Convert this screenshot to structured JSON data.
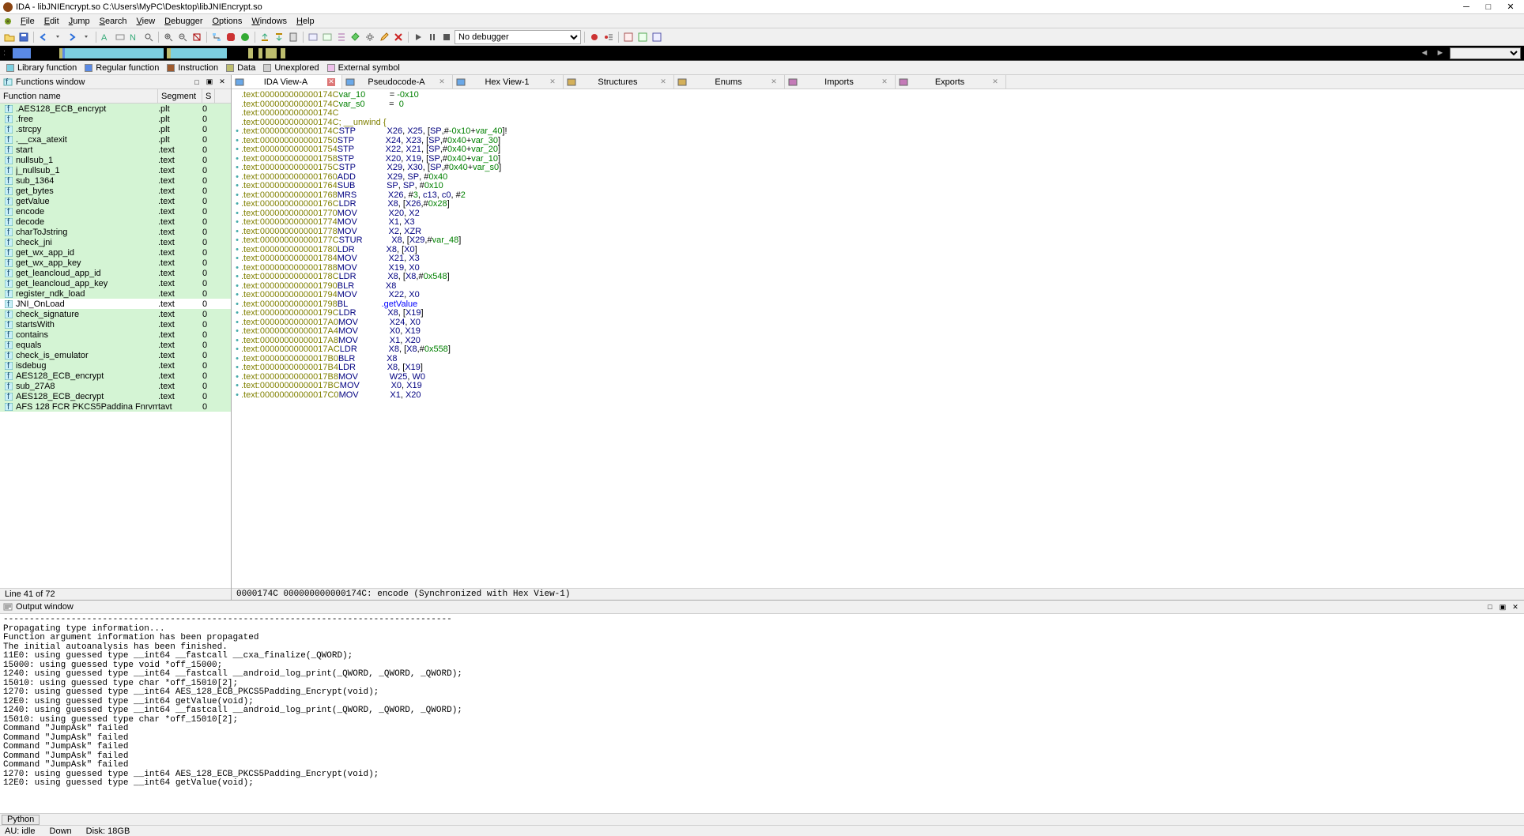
{
  "title": "IDA - libJNIEncrypt.so C:\\Users\\MyPC\\Desktop\\libJNIEncrypt.so",
  "menu": [
    "File",
    "Edit",
    "Jump",
    "Search",
    "View",
    "Debugger",
    "Options",
    "Windows",
    "Help"
  ],
  "debugger_select": "No debugger",
  "legend": [
    {
      "label": "Library function",
      "color": "#7ccfe0"
    },
    {
      "label": "Regular function",
      "color": "#5a8ae6"
    },
    {
      "label": "Instruction",
      "color": "#9e5a2e"
    },
    {
      "label": "Data",
      "color": "#bdbd6e"
    },
    {
      "label": "Unexplored",
      "color": "#d0d0d0"
    },
    {
      "label": "External symbol",
      "color": "#eec0ea"
    }
  ],
  "nav_segments": [
    {
      "color": "#5a8ae6",
      "w": 1.3
    },
    {
      "color": "#000000",
      "w": 2.0
    },
    {
      "color": "#bdbd6e",
      "w": 0.2
    },
    {
      "color": "#5a8ae6",
      "w": 0.2
    },
    {
      "color": "#7ccfe0",
      "w": 7.0
    },
    {
      "color": "#000000",
      "w": 0.2
    },
    {
      "color": "#bdbd6e",
      "w": 0.3
    },
    {
      "color": "#7ccfe0",
      "w": 4.0
    },
    {
      "color": "#000000",
      "w": 1.5
    },
    {
      "color": "#bdbd6e",
      "w": 0.3
    },
    {
      "color": "#000000",
      "w": 0.4
    },
    {
      "color": "#bdbd6e",
      "w": 0.3
    },
    {
      "color": "#000000",
      "w": 0.2
    },
    {
      "color": "#bdbd6e",
      "w": 0.8
    },
    {
      "color": "#000000",
      "w": 0.3
    },
    {
      "color": "#bdbd6e",
      "w": 0.3
    },
    {
      "color": "#000000",
      "w": 80
    }
  ],
  "functions_panel": {
    "title": "Functions window",
    "cols": [
      "Function name",
      "Segment",
      "S"
    ],
    "status": "Line 41 of 72",
    "rows": [
      {
        "name": ".AES128_ECB_encrypt",
        "seg": ".plt",
        "s": "0",
        "hl": true
      },
      {
        "name": ".free",
        "seg": ".plt",
        "s": "0",
        "hl": true
      },
      {
        "name": ".strcpy",
        "seg": ".plt",
        "s": "0",
        "hl": true
      },
      {
        "name": ".__cxa_atexit",
        "seg": ".plt",
        "s": "0",
        "hl": true
      },
      {
        "name": "start",
        "seg": ".text",
        "s": "0",
        "hl": true
      },
      {
        "name": "nullsub_1",
        "seg": ".text",
        "s": "0",
        "hl": true
      },
      {
        "name": "j_nullsub_1",
        "seg": ".text",
        "s": "0",
        "hl": true
      },
      {
        "name": "sub_1364",
        "seg": ".text",
        "s": "0",
        "hl": true
      },
      {
        "name": "get_bytes",
        "seg": ".text",
        "s": "0",
        "hl": true
      },
      {
        "name": "getValue",
        "seg": ".text",
        "s": "0",
        "hl": true
      },
      {
        "name": "encode",
        "seg": ".text",
        "s": "0",
        "hl": true
      },
      {
        "name": "decode",
        "seg": ".text",
        "s": "0",
        "hl": true
      },
      {
        "name": "charToJstring",
        "seg": ".text",
        "s": "0",
        "hl": true
      },
      {
        "name": "check_jni",
        "seg": ".text",
        "s": "0",
        "hl": true
      },
      {
        "name": "get_wx_app_id",
        "seg": ".text",
        "s": "0",
        "hl": true
      },
      {
        "name": "get_wx_app_key",
        "seg": ".text",
        "s": "0",
        "hl": true
      },
      {
        "name": "get_leancloud_app_id",
        "seg": ".text",
        "s": "0",
        "hl": true
      },
      {
        "name": "get_leancloud_app_key",
        "seg": ".text",
        "s": "0",
        "hl": true
      },
      {
        "name": "register_ndk_load",
        "seg": ".text",
        "s": "0",
        "hl": true
      },
      {
        "name": "JNI_OnLoad",
        "seg": ".text",
        "s": "0",
        "hl": false,
        "sel": true
      },
      {
        "name": "check_signature",
        "seg": ".text",
        "s": "0",
        "hl": true
      },
      {
        "name": "startsWith",
        "seg": ".text",
        "s": "0",
        "hl": true
      },
      {
        "name": "contains",
        "seg": ".text",
        "s": "0",
        "hl": true
      },
      {
        "name": "equals",
        "seg": ".text",
        "s": "0",
        "hl": true
      },
      {
        "name": "check_is_emulator",
        "seg": ".text",
        "s": "0",
        "hl": true
      },
      {
        "name": "isdebug",
        "seg": ".text",
        "s": "0",
        "hl": true
      },
      {
        "name": "AES128_ECB_encrypt",
        "seg": ".text",
        "s": "0",
        "hl": true
      },
      {
        "name": "sub_27A8",
        "seg": ".text",
        "s": "0",
        "hl": true
      },
      {
        "name": "AES128_ECB_decrypt",
        "seg": ".text",
        "s": "0",
        "hl": true
      },
      {
        "name": "AFS 128 FCR PKCS5Paddina Fnrvmnt",
        "seg": "tavt",
        "s": "0",
        "hl": true
      }
    ]
  },
  "tabs": [
    {
      "label": "IDA View-A",
      "active": true,
      "color": "#6aa8e8"
    },
    {
      "label": "Pseudocode-A",
      "active": false,
      "color": "#6aa8e8"
    },
    {
      "label": "Hex View-1",
      "active": false,
      "color": "#6aa8e8"
    },
    {
      "label": "Structures",
      "active": false,
      "color": "#d4b05a"
    },
    {
      "label": "Enums",
      "active": false,
      "color": "#d4b05a"
    },
    {
      "label": "Imports",
      "active": false,
      "color": "#c47ab8"
    },
    {
      "label": "Exports",
      "active": false,
      "color": "#c47ab8"
    }
  ],
  "disasm_status": "0000174C 000000000000174C: encode (Synchronized with Hex View-1)",
  "disasm": [
    {
      "g": "",
      "addr": ".text:000000000000174C",
      "rest": [
        [
          "var",
          "var_10"
        ],
        [
          "plain",
          "          = "
        ],
        [
          "num",
          "-0x10"
        ]
      ]
    },
    {
      "g": "",
      "addr": ".text:000000000000174C",
      "rest": [
        [
          "var",
          "var_s0"
        ],
        [
          "plain",
          "          =  "
        ],
        [
          "num",
          "0"
        ]
      ]
    },
    {
      "g": "",
      "addr": ".text:000000000000174C"
    },
    {
      "g": "",
      "addr": ".text:000000000000174C",
      "rest": [
        [
          "cmt",
          "; __unwind {"
        ]
      ]
    },
    {
      "g": "•",
      "addr": ".text:000000000000174C",
      "mnem": "STP",
      "ops": [
        [
          "reg",
          "X26"
        ],
        [
          "plain",
          ", "
        ],
        [
          "reg",
          "X25"
        ],
        [
          "plain",
          ", ["
        ],
        [
          "reg",
          "SP"
        ],
        [
          "plain",
          ",#"
        ],
        [
          "num",
          "-0x10"
        ],
        [
          "plain",
          "+"
        ],
        [
          "var",
          "var_40"
        ],
        [
          "plain",
          "]!"
        ]
      ]
    },
    {
      "g": "•",
      "addr": ".text:0000000000001750",
      "mnem": "STP",
      "ops": [
        [
          "reg",
          "X24"
        ],
        [
          "plain",
          ", "
        ],
        [
          "reg",
          "X23"
        ],
        [
          "plain",
          ", ["
        ],
        [
          "reg",
          "SP"
        ],
        [
          "plain",
          ",#"
        ],
        [
          "num",
          "0x40"
        ],
        [
          "plain",
          "+"
        ],
        [
          "var",
          "var_30"
        ],
        [
          "plain",
          "]"
        ]
      ]
    },
    {
      "g": "•",
      "addr": ".text:0000000000001754",
      "mnem": "STP",
      "ops": [
        [
          "reg",
          "X22"
        ],
        [
          "plain",
          ", "
        ],
        [
          "reg",
          "X21"
        ],
        [
          "plain",
          ", ["
        ],
        [
          "reg",
          "SP"
        ],
        [
          "plain",
          ",#"
        ],
        [
          "num",
          "0x40"
        ],
        [
          "plain",
          "+"
        ],
        [
          "var",
          "var_20"
        ],
        [
          "plain",
          "]"
        ]
      ]
    },
    {
      "g": "•",
      "addr": ".text:0000000000001758",
      "mnem": "STP",
      "ops": [
        [
          "reg",
          "X20"
        ],
        [
          "plain",
          ", "
        ],
        [
          "reg",
          "X19"
        ],
        [
          "plain",
          ", ["
        ],
        [
          "reg",
          "SP"
        ],
        [
          "plain",
          ",#"
        ],
        [
          "num",
          "0x40"
        ],
        [
          "plain",
          "+"
        ],
        [
          "var",
          "var_10"
        ],
        [
          "plain",
          "]"
        ]
      ]
    },
    {
      "g": "•",
      "addr": ".text:000000000000175C",
      "mnem": "STP",
      "ops": [
        [
          "reg",
          "X29"
        ],
        [
          "plain",
          ", "
        ],
        [
          "reg",
          "X30"
        ],
        [
          "plain",
          ", ["
        ],
        [
          "reg",
          "SP"
        ],
        [
          "plain",
          ",#"
        ],
        [
          "num",
          "0x40"
        ],
        [
          "plain",
          "+"
        ],
        [
          "var",
          "var_s0"
        ],
        [
          "plain",
          "]"
        ]
      ]
    },
    {
      "g": "•",
      "addr": ".text:0000000000001760",
      "mnem": "ADD",
      "ops": [
        [
          "reg",
          "X29"
        ],
        [
          "plain",
          ", "
        ],
        [
          "reg",
          "SP"
        ],
        [
          "plain",
          ", #"
        ],
        [
          "num",
          "0x40"
        ]
      ]
    },
    {
      "g": "•",
      "addr": ".text:0000000000001764",
      "mnem": "SUB",
      "ops": [
        [
          "reg",
          "SP"
        ],
        [
          "plain",
          ", "
        ],
        [
          "reg",
          "SP"
        ],
        [
          "plain",
          ", #"
        ],
        [
          "num",
          "0x10"
        ]
      ]
    },
    {
      "g": "•",
      "addr": ".text:0000000000001768",
      "mnem": "MRS",
      "ops": [
        [
          "reg",
          "X26"
        ],
        [
          "plain",
          ", #"
        ],
        [
          "num",
          "3"
        ],
        [
          "plain",
          ", "
        ],
        [
          "reg",
          "c13"
        ],
        [
          "plain",
          ", "
        ],
        [
          "reg",
          "c0"
        ],
        [
          "plain",
          ", #"
        ],
        [
          "num",
          "2"
        ]
      ]
    },
    {
      "g": "•",
      "addr": ".text:000000000000176C",
      "mnem": "LDR",
      "ops": [
        [
          "reg",
          "X8"
        ],
        [
          "plain",
          ", ["
        ],
        [
          "reg",
          "X26"
        ],
        [
          "plain",
          ",#"
        ],
        [
          "num",
          "0x28"
        ],
        [
          "plain",
          "]"
        ]
      ]
    },
    {
      "g": "•",
      "addr": ".text:0000000000001770",
      "mnem": "MOV",
      "ops": [
        [
          "reg",
          "X20"
        ],
        [
          "plain",
          ", "
        ],
        [
          "reg",
          "X2"
        ]
      ]
    },
    {
      "g": "•",
      "addr": ".text:0000000000001774",
      "mnem": "MOV",
      "ops": [
        [
          "reg",
          "X1"
        ],
        [
          "plain",
          ", "
        ],
        [
          "reg",
          "X3"
        ]
      ]
    },
    {
      "g": "•",
      "addr": ".text:0000000000001778",
      "mnem": "MOV",
      "ops": [
        [
          "reg",
          "X2"
        ],
        [
          "plain",
          ", "
        ],
        [
          "reg",
          "XZR"
        ]
      ]
    },
    {
      "g": "•",
      "addr": ".text:000000000000177C",
      "mnem": "STUR",
      "ops": [
        [
          "reg",
          "X8"
        ],
        [
          "plain",
          ", ["
        ],
        [
          "reg",
          "X29"
        ],
        [
          "plain",
          ",#"
        ],
        [
          "var",
          "var_48"
        ],
        [
          "plain",
          "]"
        ]
      ]
    },
    {
      "g": "•",
      "addr": ".text:0000000000001780",
      "mnem": "LDR",
      "ops": [
        [
          "reg",
          "X8"
        ],
        [
          "plain",
          ", ["
        ],
        [
          "reg",
          "X0"
        ],
        [
          "plain",
          "]"
        ]
      ]
    },
    {
      "g": "•",
      "addr": ".text:0000000000001784",
      "mnem": "MOV",
      "ops": [
        [
          "reg",
          "X21"
        ],
        [
          "plain",
          ", "
        ],
        [
          "reg",
          "X3"
        ]
      ]
    },
    {
      "g": "•",
      "addr": ".text:0000000000001788",
      "mnem": "MOV",
      "ops": [
        [
          "reg",
          "X19"
        ],
        [
          "plain",
          ", "
        ],
        [
          "reg",
          "X0"
        ]
      ]
    },
    {
      "g": "•",
      "addr": ".text:000000000000178C",
      "mnem": "LDR",
      "ops": [
        [
          "reg",
          "X8"
        ],
        [
          "plain",
          ", ["
        ],
        [
          "reg",
          "X8"
        ],
        [
          "plain",
          ",#"
        ],
        [
          "num",
          "0x548"
        ],
        [
          "plain",
          "]"
        ]
      ]
    },
    {
      "g": "•",
      "addr": ".text:0000000000001790",
      "mnem": "BLR",
      "ops": [
        [
          "reg",
          "X8"
        ]
      ]
    },
    {
      "g": "•",
      "addr": ".text:0000000000001794",
      "mnem": "MOV",
      "ops": [
        [
          "reg",
          "X22"
        ],
        [
          "plain",
          ", "
        ],
        [
          "reg",
          "X0"
        ]
      ]
    },
    {
      "g": "•",
      "addr": ".text:0000000000001798",
      "mnem": "BL",
      "ops": [
        [
          "call",
          ".getValue"
        ]
      ]
    },
    {
      "g": "•",
      "addr": ".text:000000000000179C",
      "mnem": "LDR",
      "ops": [
        [
          "reg",
          "X8"
        ],
        [
          "plain",
          ", ["
        ],
        [
          "reg",
          "X19"
        ],
        [
          "plain",
          "]"
        ]
      ]
    },
    {
      "g": "•",
      "addr": ".text:00000000000017A0",
      "mnem": "MOV",
      "ops": [
        [
          "reg",
          "X24"
        ],
        [
          "plain",
          ", "
        ],
        [
          "reg",
          "X0"
        ]
      ]
    },
    {
      "g": "•",
      "addr": ".text:00000000000017A4",
      "mnem": "MOV",
      "ops": [
        [
          "reg",
          "X0"
        ],
        [
          "plain",
          ", "
        ],
        [
          "reg",
          "X19"
        ]
      ]
    },
    {
      "g": "•",
      "addr": ".text:00000000000017A8",
      "mnem": "MOV",
      "ops": [
        [
          "reg",
          "X1"
        ],
        [
          "plain",
          ", "
        ],
        [
          "reg",
          "X20"
        ]
      ]
    },
    {
      "g": "•",
      "addr": ".text:00000000000017AC",
      "mnem": "LDR",
      "ops": [
        [
          "reg",
          "X8"
        ],
        [
          "plain",
          ", ["
        ],
        [
          "reg",
          "X8"
        ],
        [
          "plain",
          ",#"
        ],
        [
          "num",
          "0x558"
        ],
        [
          "plain",
          "]"
        ]
      ]
    },
    {
      "g": "•",
      "addr": ".text:00000000000017B0",
      "mnem": "BLR",
      "ops": [
        [
          "reg",
          "X8"
        ]
      ]
    },
    {
      "g": "•",
      "addr": ".text:00000000000017B4",
      "mnem": "LDR",
      "ops": [
        [
          "reg",
          "X8"
        ],
        [
          "plain",
          ", ["
        ],
        [
          "reg",
          "X19"
        ],
        [
          "plain",
          "]"
        ]
      ]
    },
    {
      "g": "•",
      "addr": ".text:00000000000017B8",
      "mnem": "MOV",
      "ops": [
        [
          "reg",
          "W25"
        ],
        [
          "plain",
          ", "
        ],
        [
          "reg",
          "W0"
        ]
      ]
    },
    {
      "g": "•",
      "addr": ".text:00000000000017BC",
      "mnem": "MOV",
      "ops": [
        [
          "reg",
          "X0"
        ],
        [
          "plain",
          ", "
        ],
        [
          "reg",
          "X19"
        ]
      ]
    },
    {
      "g": "•",
      "addr": ".text:00000000000017C0",
      "mnem": "MOV",
      "ops": [
        [
          "reg",
          "X1"
        ],
        [
          "plain",
          ", "
        ],
        [
          "reg",
          "X20"
        ]
      ]
    }
  ],
  "output": {
    "title": "Output window",
    "lines": [
      "--------------------------------------------------------------------------------------",
      "Propagating type information...",
      "Function argument information has been propagated",
      "The initial autoanalysis has been finished.",
      "11E0: using guessed type __int64 __fastcall __cxa_finalize(_QWORD);",
      "15000: using guessed type void *off_15000;",
      "1240: using guessed type __int64 __fastcall __android_log_print(_QWORD, _QWORD, _QWORD);",
      "15010: using guessed type char *off_15010[2];",
      "1270: using guessed type __int64 AES_128_ECB_PKCS5Padding_Encrypt(void);",
      "12E0: using guessed type __int64 getValue(void);",
      "1240: using guessed type __int64 __fastcall __android_log_print(_QWORD, _QWORD, _QWORD);",
      "15010: using guessed type char *off_15010[2];",
      "Command \"JumpAsk\" failed",
      "Command \"JumpAsk\" failed",
      "Command \"JumpAsk\" failed",
      "Command \"JumpAsk\" failed",
      "Command \"JumpAsk\" failed",
      "1270: using guessed type __int64 AES_128_ECB_PKCS5Padding_Encrypt(void);",
      "12E0: using guessed type __int64 getValue(void);"
    ],
    "python_label": "Python"
  },
  "status": {
    "au": "AU: idle",
    "down": "Down",
    "disk": "Disk: 18GB"
  }
}
